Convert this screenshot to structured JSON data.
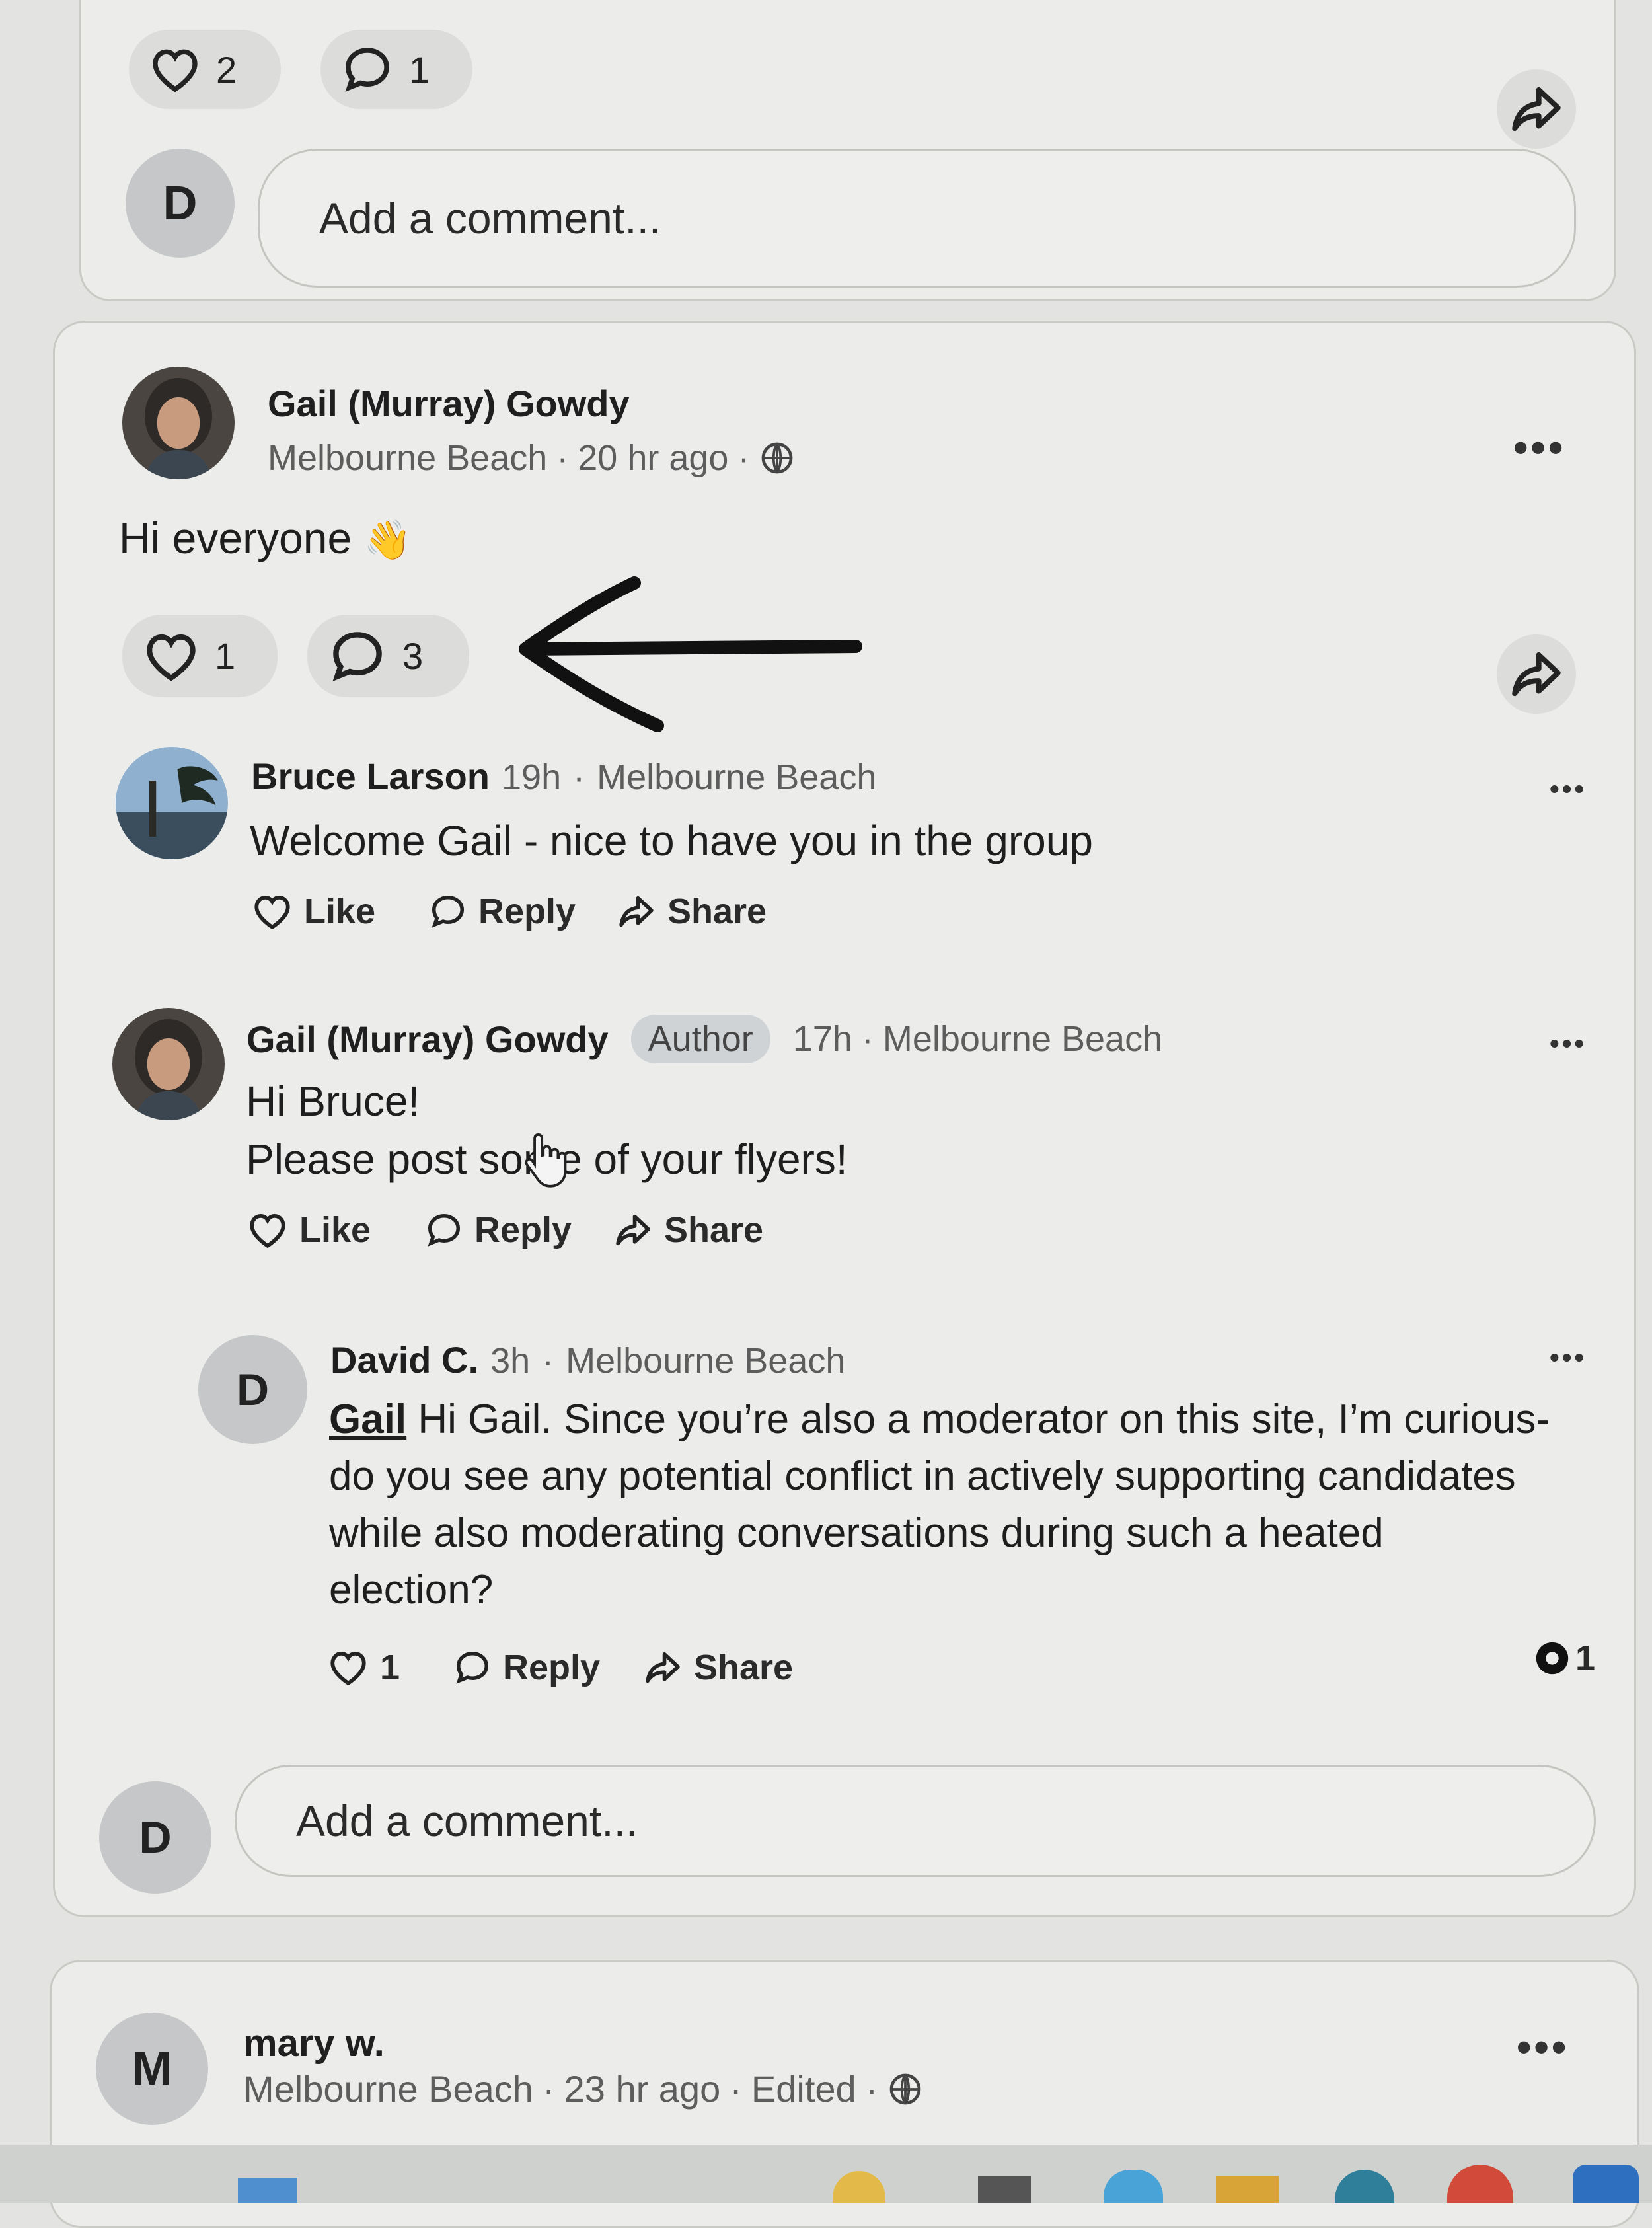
{
  "top_post": {
    "like_count": "2",
    "comment_count": "1",
    "commenter_initial": "D",
    "comment_placeholder": "Add a comment..."
  },
  "post": {
    "author": "Gail (Murray) Gowdy",
    "location": "Melbourne Beach",
    "time": "20 hr ago",
    "text": "Hi everyone",
    "emoji": "👋",
    "like_count": "1",
    "comment_count": "3",
    "comments": [
      {
        "author": "Bruce Larson",
        "time": "19h",
        "location": "Melbourne Beach",
        "lines": [
          "Welcome Gail - nice to have you in the group"
        ],
        "actions": {
          "like": "Like",
          "reply": "Reply",
          "share": "Share"
        }
      },
      {
        "author": "Gail (Murray) Gowdy",
        "badge": "Author",
        "time": "17h",
        "location": "Melbourne Beach",
        "lines": [
          "Hi Bruce!",
          "Please post some of your flyers!"
        ],
        "actions": {
          "like": "Like",
          "reply": "Reply",
          "share": "Share"
        }
      },
      {
        "author": "David C.",
        "initial": "D",
        "time": "3h",
        "location": "Melbourne Beach",
        "mention": "Gail",
        "lines": [
          "Hi Gail. Since you’re also a moderator on this site, I’m curious-",
          "do you see any potential conflict in actively supporting candidates",
          "while also moderating conversations during such a heated",
          "election?"
        ],
        "like_count": "1",
        "actions": {
          "reply": "Reply",
          "share": "Share"
        },
        "reaction_count": "1"
      }
    ],
    "commenter_initial": "D",
    "comment_placeholder": "Add a comment..."
  },
  "next_post": {
    "initial": "M",
    "author": "mary w.",
    "location": "Melbourne Beach",
    "time": "23 hr ago",
    "edited": "Edited"
  },
  "colors": {
    "background": "#e3e4e1",
    "card": "#ecedea",
    "pill": "#dcdddb",
    "avatar_letter_bg": "#c5c7c9",
    "author_badge": "#cfd3d6",
    "arrow_annotation": "#111111"
  },
  "icons": [
    "heart-icon",
    "comment-icon",
    "share-icon",
    "globe-icon",
    "more-icon",
    "waving-hand-icon",
    "hand-cursor-icon"
  ]
}
